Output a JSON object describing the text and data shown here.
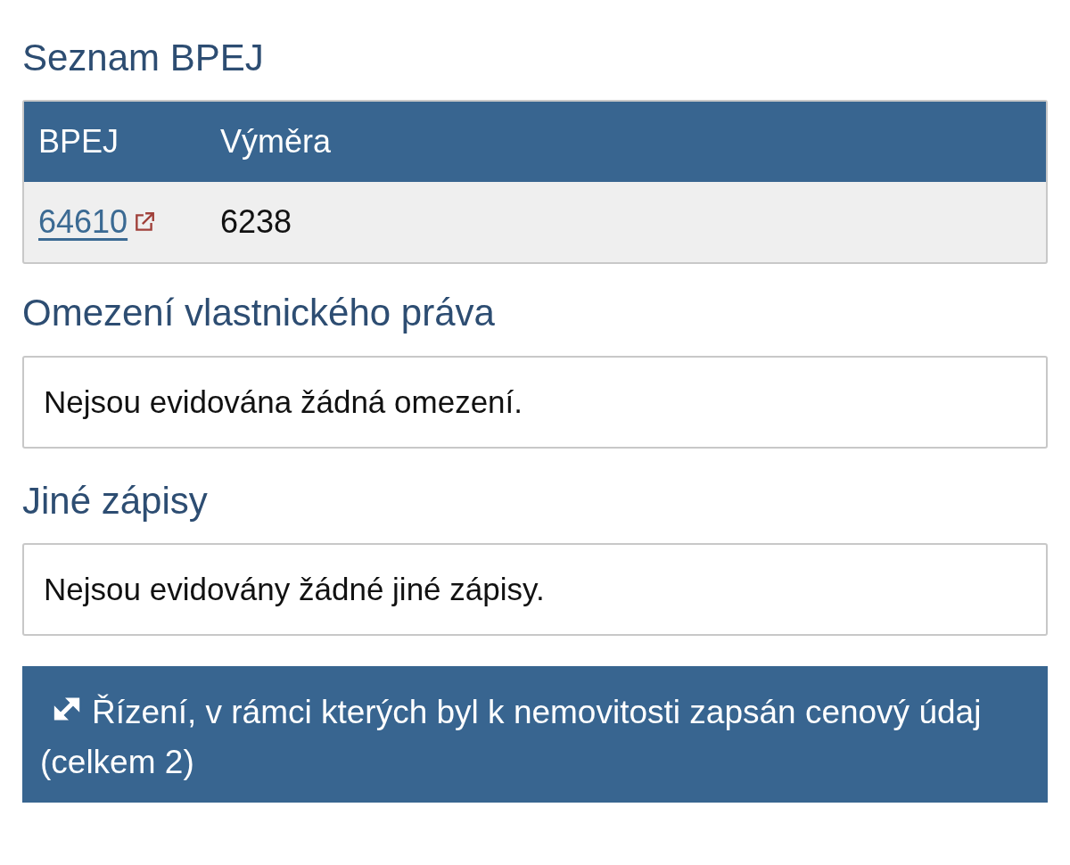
{
  "sections": [
    {
      "kind": "table",
      "title": "Seznam BPEJ",
      "columns": [
        "BPEJ",
        "Výměra"
      ],
      "rows": [
        {
          "code": "64610",
          "area": "6238"
        }
      ]
    },
    {
      "kind": "note",
      "title": "Omezení vlastnického práva",
      "text": "Nejsou evidována žádná omezení."
    },
    {
      "kind": "note",
      "title": "Jiné zápisy",
      "text": "Nejsou evidovány žádné jiné zápisy."
    },
    {
      "kind": "expander",
      "label": "Řízení, v rámci kterých byl k nemovitosti zapsán cenový údaj (celkem 2)",
      "expanded": false
    }
  ]
}
